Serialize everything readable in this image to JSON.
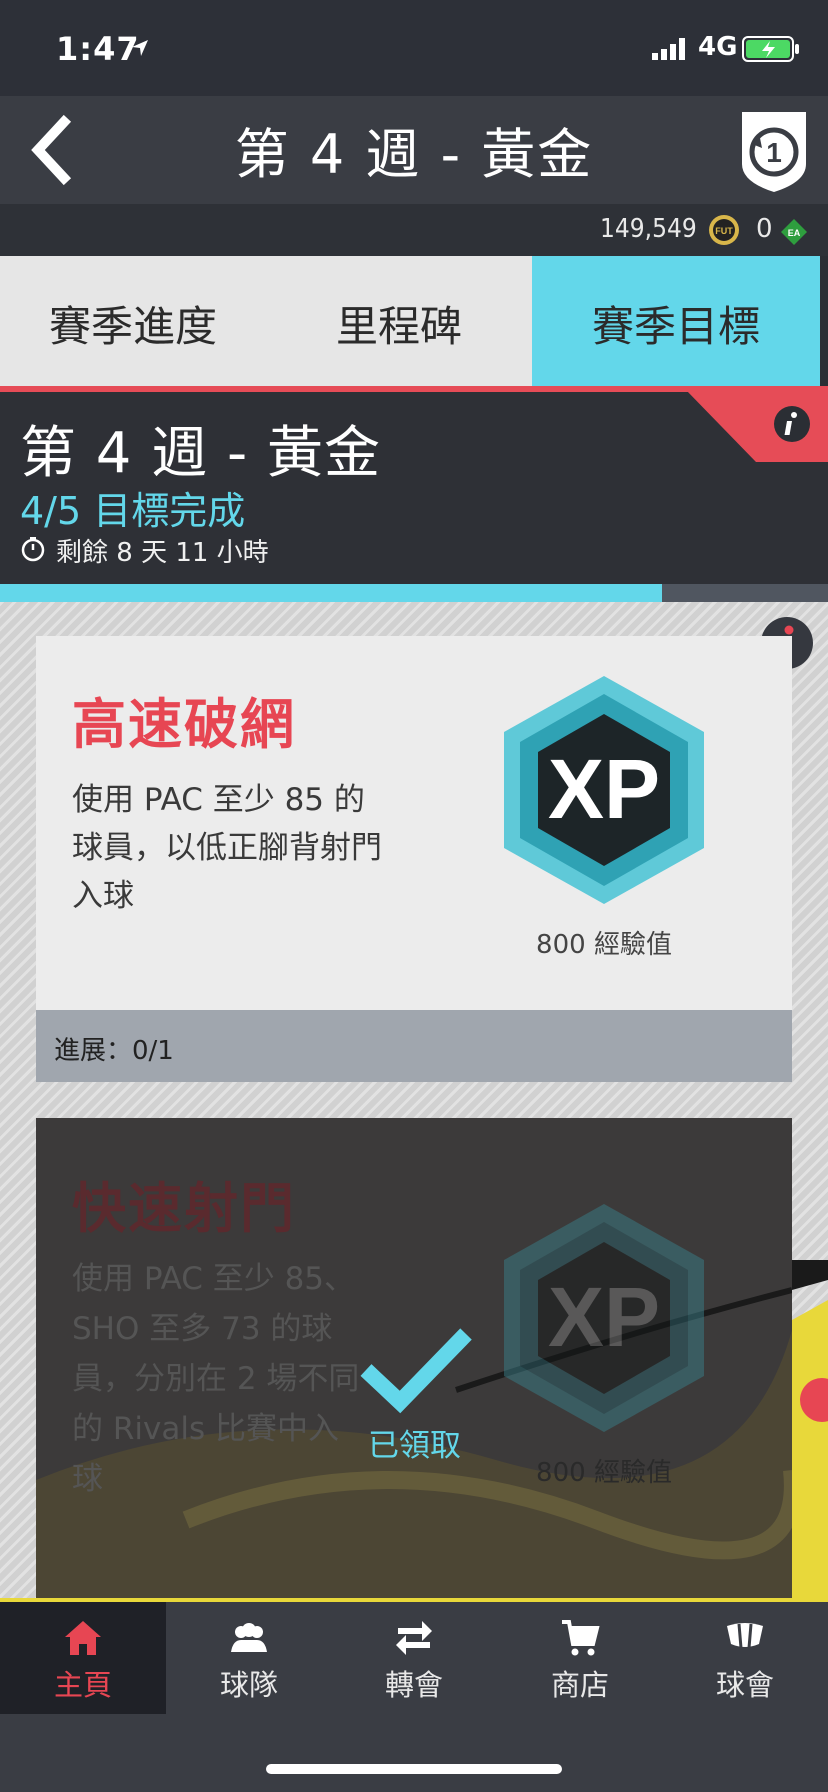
{
  "status": {
    "time": "1:47",
    "network": "4G"
  },
  "header": {
    "title": "第 4 週 - 黃金",
    "season_number": "1"
  },
  "currency": {
    "coins": "149,549",
    "coin_label": "FUT",
    "points": "0",
    "points_label": "EA"
  },
  "tabs": [
    {
      "label": "賽季進度",
      "active": false
    },
    {
      "label": "里程碑",
      "active": false
    },
    {
      "label": "賽季目標",
      "active": true
    }
  ],
  "week": {
    "title": "第 4 週 - 黃金",
    "progress": "4/5 目標完成",
    "time_left": "剩餘 8 天 11 小時",
    "progress_fraction": 0.8
  },
  "objectives": [
    {
      "title": "高速破網",
      "description": "使用 PAC 至少 85 的球員，以低正腳背射門入球",
      "reward_label": "800 經驗值",
      "reward_icon_text": "XP",
      "progress": "進展：0/1"
    },
    {
      "title": "快速射門",
      "description": "使用 PAC 至少 85、SHO 至多 73 的球員，分別在 2 場不同的 Rivals 比賽中入球",
      "reward_label": "800 經驗值",
      "reward_icon_text": "XP",
      "status": "已領取"
    }
  ],
  "nav": [
    {
      "label": "主頁",
      "icon": "home-icon"
    },
    {
      "label": "球隊",
      "icon": "club-icon"
    },
    {
      "label": "轉會",
      "icon": "transfer-icon"
    },
    {
      "label": "商店",
      "icon": "store-icon"
    },
    {
      "label": "球會",
      "icon": "fc-icon"
    }
  ],
  "colors": {
    "accent": "#63d7ea",
    "red": "#e74653",
    "bar": "#3a3d44"
  }
}
